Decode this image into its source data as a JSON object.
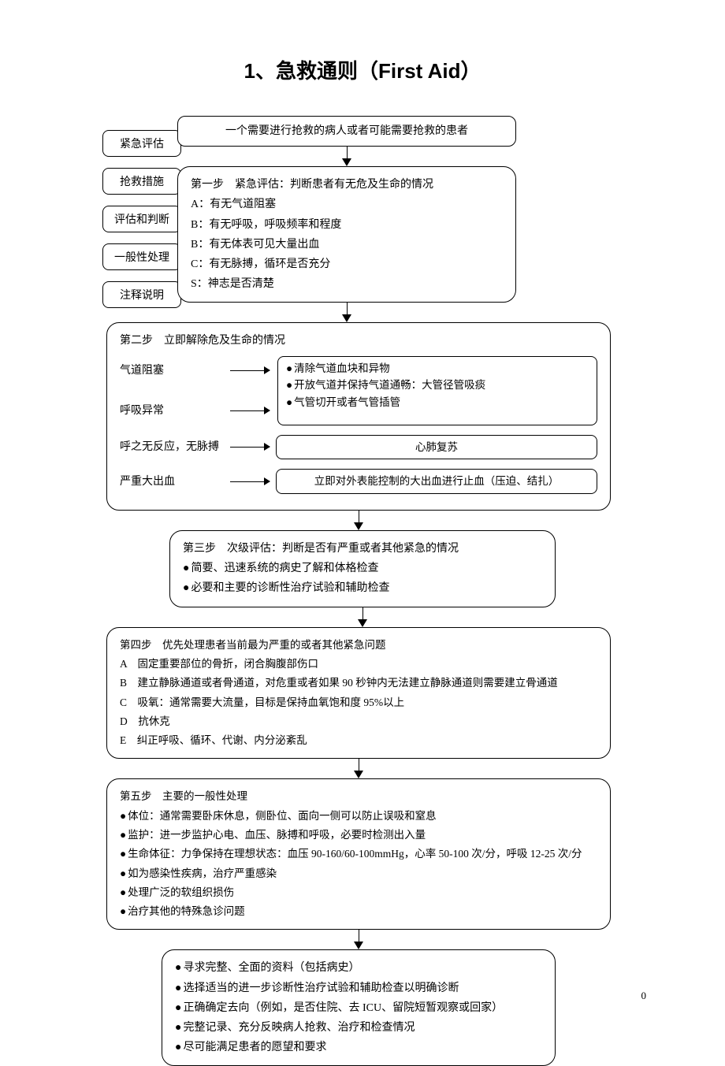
{
  "title": "1、急救通则（First Aid）",
  "page_number": "0",
  "legend": {
    "items": [
      "紧急评估",
      "抢救措施",
      "评估和判断",
      "一般性处理",
      "注释说明"
    ]
  },
  "flow": {
    "start": "一个需要进行抢救的病人或者可能需要抢救的患者",
    "step1": {
      "heading": "第一步　紧急评估：判断患者有无危及生命的情况",
      "lines": [
        "A：有无气道阻塞",
        "B：有无呼吸，呼吸频率和程度",
        "B：有无体表可见大量出血",
        "C：有无脉搏，循环是否充分",
        "S：神志是否清楚"
      ]
    },
    "step2": {
      "heading": "第二步　立即解除危及生命的情况",
      "rows": [
        {
          "label": "气道阻塞",
          "targets": [
            "清除气道血块和异物",
            "开放气道并保持气道通畅：大管径管吸痰",
            "气管切开或者气管插管"
          ],
          "merge_with_next": true
        },
        {
          "label": "呼吸异常"
        },
        {
          "label": "呼之无反应，无脉搏",
          "single": "心肺复苏"
        },
        {
          "label": "严重大出血",
          "single": "立即对外表能控制的大出血进行止血（压迫、结扎）"
        }
      ]
    },
    "step3": {
      "heading": "第三步　次级评估：判断是否有严重或者其他紧急的情况",
      "lines": [
        "简要、迅速系统的病史了解和体格检查",
        "必要和主要的诊断性治疗试验和辅助检查"
      ]
    },
    "step4": {
      "heading": "第四步　优先处理患者当前最为严重的或者其他紧急问题",
      "lines": [
        "A　固定重要部位的骨折，闭合胸腹部伤口",
        "B　建立静脉通道或者骨通道，对危重或者如果 90 秒钟内无法建立静脉通道则需要建立骨通道",
        "C　吸氧：通常需要大流量，目标是保持血氧饱和度 95%以上",
        "D　抗休克",
        "E　纠正呼吸、循环、代谢、内分泌紊乱"
      ]
    },
    "step5": {
      "heading": "第五步　主要的一般性处理",
      "lines": [
        "体位：通常需要卧床休息，侧卧位、面向一侧可以防止误吸和窒息",
        "监护：进一步监护心电、血压、脉搏和呼吸，必要时检测出入量",
        "生命体征：力争保持在理想状态：血压 90-160/60-100mmHg，心率 50-100 次/分，呼吸 12-25 次/分",
        "如为感染性疾病，治疗严重感染",
        "处理广泛的软组织损伤",
        "治疗其他的特殊急诊问题"
      ]
    },
    "final": {
      "lines": [
        "寻求完整、全面的资料（包括病史）",
        "选择适当的进一步诊断性治疗试验和辅助检查以明确诊断",
        "正确确定去向（例如，是否住院、去 ICU、留院短暂观察或回家）",
        "完整记录、充分反映病人抢救、治疗和检查情况",
        "尽可能满足患者的愿望和要求"
      ]
    }
  }
}
